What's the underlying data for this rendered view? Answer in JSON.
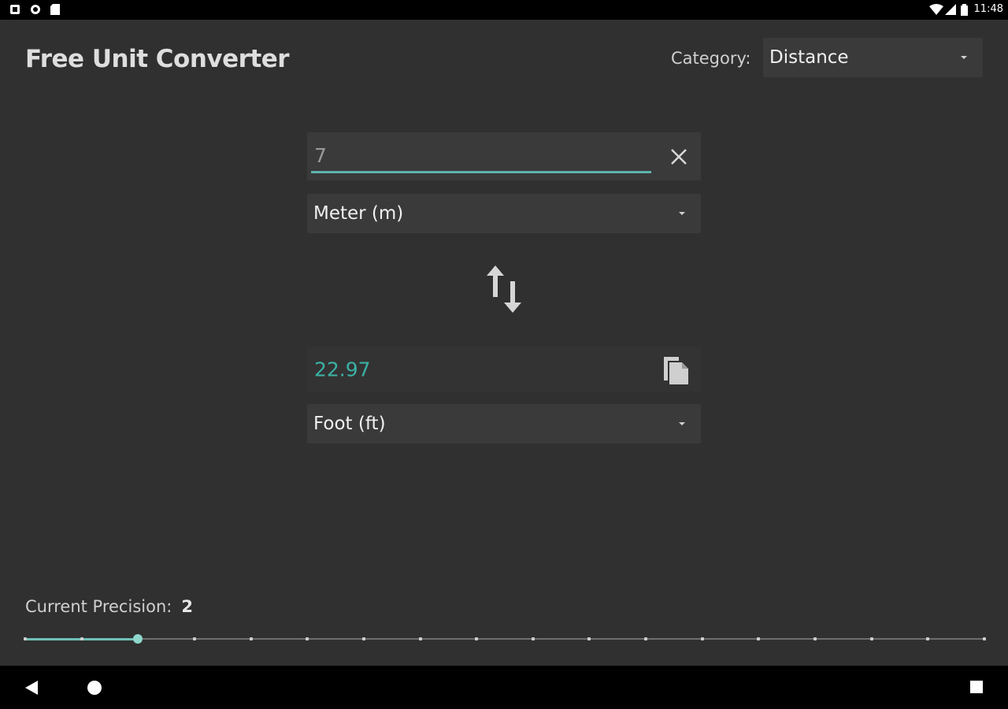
{
  "status_bar": {
    "time": "11:48",
    "left_icons": [
      "notification-icon",
      "sync-icon",
      "sd-card-icon"
    ],
    "right_icons": [
      "wifi-icon",
      "signal-icon",
      "battery-icon"
    ]
  },
  "app": {
    "title": "Free Unit Converter",
    "category_label": "Category:",
    "category_value": "Distance"
  },
  "converter": {
    "input_value": "7",
    "from_unit": "Meter (m)",
    "to_unit": "Foot (ft)",
    "result_value": "22.97",
    "accent_color": "#3bb1a4"
  },
  "precision": {
    "label": "Current Precision:",
    "value": "2",
    "level": 2,
    "max": 17
  },
  "nav_bar": {
    "buttons": [
      "back-icon",
      "home-icon",
      "recents-icon"
    ]
  }
}
